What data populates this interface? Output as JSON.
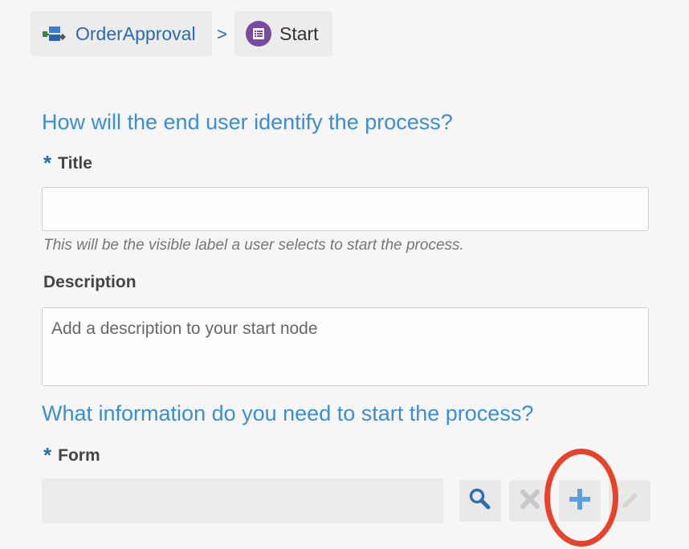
{
  "breadcrumb": {
    "process_name": "OrderApproval",
    "separator": ">",
    "current_node": "Start"
  },
  "identify_section": {
    "heading": "How will the end user identify the process?",
    "title_field": {
      "required_marker": "*",
      "label": "Title",
      "value": "",
      "hint": "This will be the visible label a user selects to start the process."
    },
    "description_field": {
      "label": "Description",
      "value": "",
      "placeholder": "Add a description to your start node"
    }
  },
  "information_section": {
    "heading": "What information do you need to start the process?",
    "form_field": {
      "required_marker": "*",
      "label": "Form",
      "value": ""
    },
    "tools": {
      "search_icon": "search-icon",
      "remove_icon": "close-icon",
      "add_icon": "plus-icon",
      "edit_icon": "pencil-icon"
    }
  },
  "colors": {
    "accent": "#3a8ed3",
    "link": "#2d6aad",
    "annotation": "#e8422a",
    "start_icon": "#7a4a9e"
  }
}
